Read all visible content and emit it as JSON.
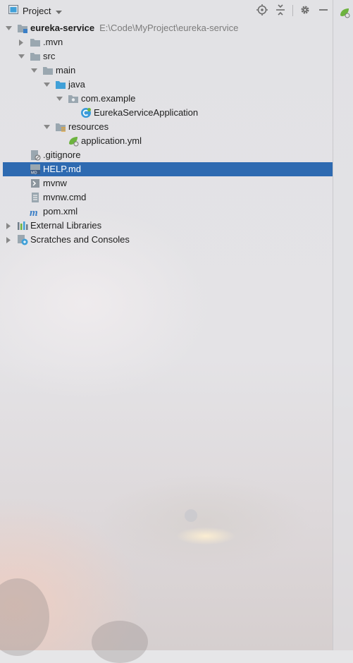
{
  "header": {
    "title": "Project"
  },
  "tree": {
    "root_label": "eureka-service",
    "root_path": "E:\\Code\\MyProject\\eureka-service",
    "items": [
      ".mvn",
      "src",
      "main",
      "java",
      "com.example",
      "EurekaServiceApplication",
      "resources",
      "application.yml",
      ".gitignore",
      "HELP.md",
      "mvnw",
      "mvnw.cmd",
      "pom.xml",
      "External Libraries",
      "Scratches and Consoles"
    ]
  },
  "colors": {
    "selection": "#2e6ab1",
    "folder": "#9aa7b0",
    "source_folder": "#40a0d8",
    "class_icon": "#3a9ad9",
    "spring": "#6db33f"
  },
  "icons": [
    "project-view-icon",
    "chevron-down-icon",
    "locate-icon",
    "collapse-all-icon",
    "gear-icon",
    "minimize-icon",
    "spring-icon"
  ]
}
